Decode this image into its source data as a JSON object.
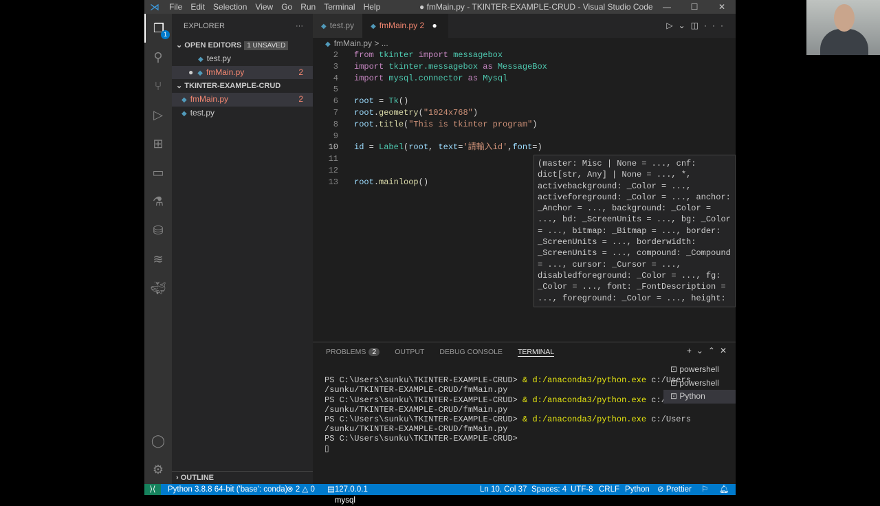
{
  "titlebar": {
    "menu": [
      "File",
      "Edit",
      "Selection",
      "View",
      "Go",
      "Run",
      "Terminal",
      "Help"
    ],
    "title": "● fmMain.py - TKINTER-EXAMPLE-CRUD - Visual Studio Code"
  },
  "activity": {
    "explorer_badge": "1"
  },
  "sidebar": {
    "title": "EXPLORER",
    "open_editors": "OPEN EDITORS",
    "unsaved": "1 UNSAVED",
    "open_files": [
      {
        "name": "test.py",
        "count": ""
      },
      {
        "name": "fmMain.py",
        "count": "2"
      }
    ],
    "folder": "TKINTER-EXAMPLE-CRUD",
    "files": [
      {
        "name": "fmMain.py",
        "count": "2"
      },
      {
        "name": "test.py",
        "count": ""
      }
    ],
    "outline": "OUTLINE"
  },
  "tabs": [
    {
      "label": "test.py"
    },
    {
      "label": "fmMain.py 2"
    }
  ],
  "breadcrumb": "fmMain.py > ...",
  "code": {
    "line_numbers": [
      "2",
      "3",
      "4",
      "5",
      "6",
      "7",
      "8",
      "9",
      "10",
      "11",
      "12",
      "13"
    ]
  },
  "hover": "(master: Misc | None = ..., cnf: dict[str, Any] | None = ..., *, activebackground: _Color = ..., activeforeground: _Color = ..., anchor: _Anchor = ..., background: _Color = ..., bd: _ScreenUnits = ..., bg: _Color = ..., bitmap: _Bitmap = ..., border: _ScreenUnits = ..., borderwidth: _ScreenUnits = ..., compound: _Compound = ..., cursor: _Cursor = ..., disabledforeground: _Color = ..., fg: _Color = ..., font: _FontDescription = ..., foreground: _Color = ..., height:",
  "panel": {
    "tabs": [
      "PROBLEMS",
      "OUTPUT",
      "DEBUG CONSOLE",
      "TERMINAL"
    ],
    "problems_count": "2",
    "terminal": [
      [
        "PS C:\\Users\\sunku\\TKINTER-EXAMPLE-CRUD> ",
        "& d:/anaconda3/python.exe",
        " c:/Users"
      ],
      [
        "/sunku/TKINTER-EXAMPLE-CRUD/fmMain.py",
        "",
        ""
      ],
      [
        "PS C:\\Users\\sunku\\TKINTER-EXAMPLE-CRUD> ",
        "& d:/anaconda3/python.exe",
        " c:/Users"
      ],
      [
        "/sunku/TKINTER-EXAMPLE-CRUD/fmMain.py",
        "",
        ""
      ],
      [
        "PS C:\\Users\\sunku\\TKINTER-EXAMPLE-CRUD> ",
        "& d:/anaconda3/python.exe",
        " c:/Users"
      ],
      [
        "/sunku/TKINTER-EXAMPLE-CRUD/fmMain.py",
        "",
        ""
      ],
      [
        "PS C:\\Users\\sunku\\TKINTER-EXAMPLE-CRUD>",
        "",
        ""
      ]
    ],
    "terminals": [
      "powershell",
      "powershell",
      "Python"
    ]
  },
  "status": {
    "interpreter": "Python 3.8.8 64-bit ('base': conda)",
    "errors": "⊗ 2 △ 0",
    "db": "127.0.0.1  mysql",
    "position": "Ln 10, Col 37",
    "spaces": "Spaces: 4",
    "encoding": "UTF-8",
    "eol": "CRLF",
    "language": "Python",
    "prettier": "⊘ Prettier"
  }
}
